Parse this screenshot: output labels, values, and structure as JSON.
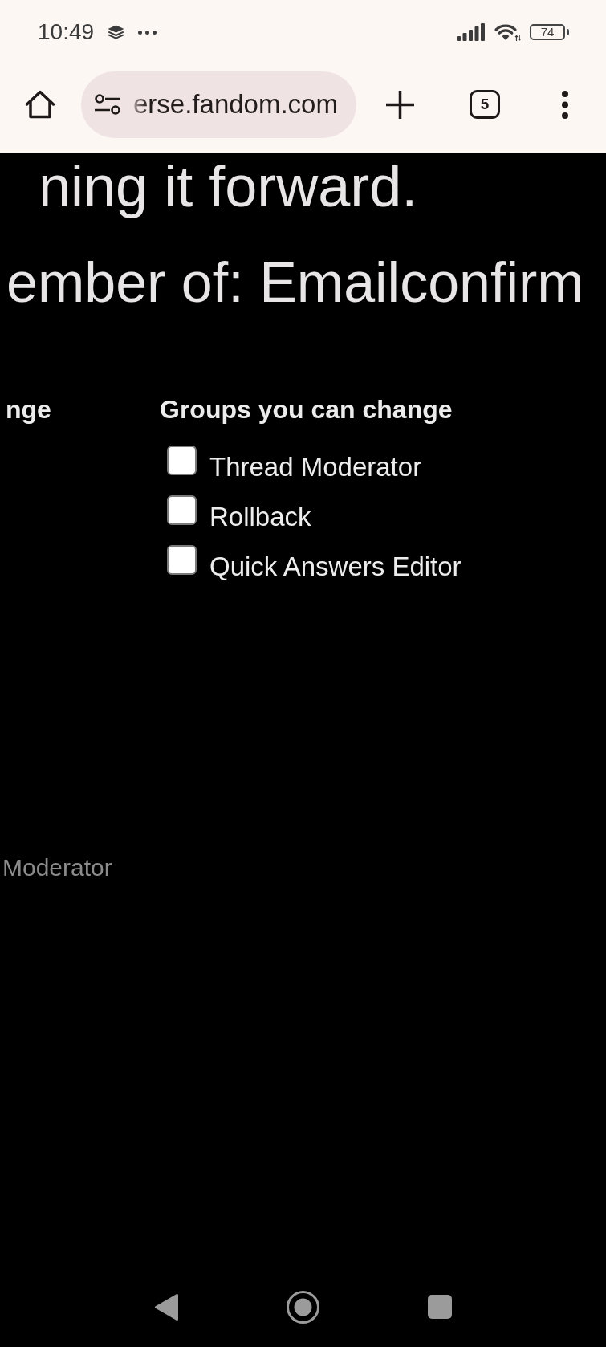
{
  "status_bar": {
    "time": "10:49",
    "battery": "74"
  },
  "toolbar": {
    "url": "erse.fandom.com",
    "tab_count": "5"
  },
  "page": {
    "paragraph_end": "ning it forward.",
    "heading": "ember of: Emailconfirm",
    "left_column": {
      "heading": "nge"
    },
    "right_column": {
      "heading": "Groups you can change",
      "groups": [
        {
          "label": "Thread Moderator",
          "checked": false
        },
        {
          "label": "Rollback",
          "checked": false
        },
        {
          "label": "Quick Answers Editor",
          "checked": false
        }
      ]
    },
    "lower_left_text": "Moderator"
  }
}
